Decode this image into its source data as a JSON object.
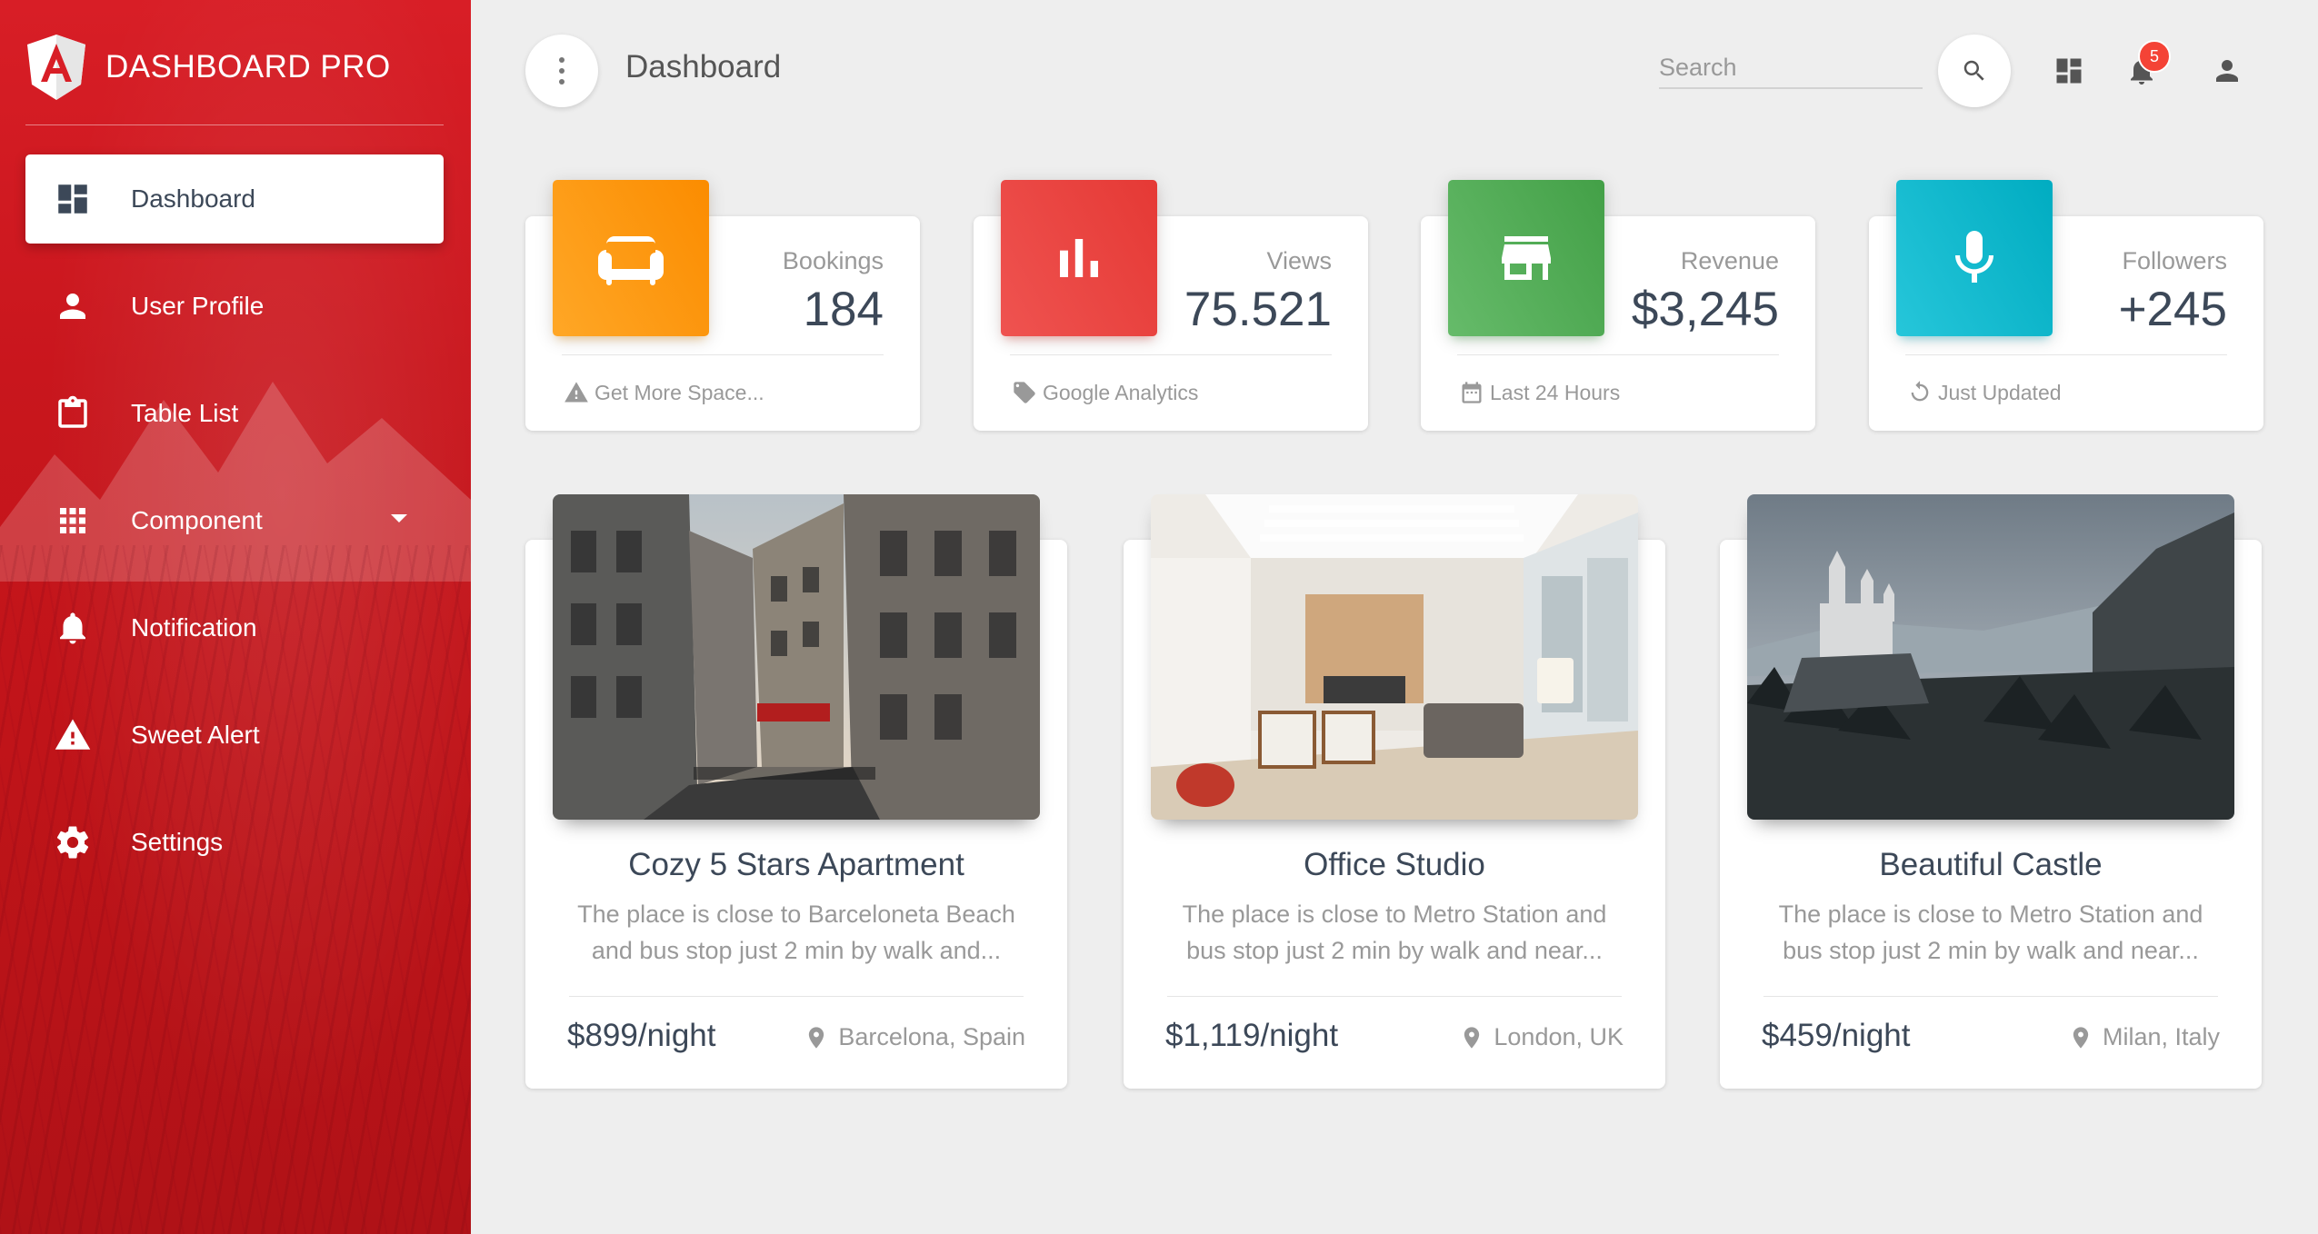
{
  "brand": {
    "title": "DASHBOARD PRO",
    "logo_letter": "A"
  },
  "sidebar": {
    "items": [
      {
        "label": "Dashboard",
        "icon": "dashboard-icon",
        "active": true
      },
      {
        "label": "User Profile",
        "icon": "person-icon",
        "active": false
      },
      {
        "label": "Table List",
        "icon": "clipboard-icon",
        "active": false
      },
      {
        "label": "Component",
        "icon": "apps-grid-icon",
        "active": false,
        "has_dropdown": true
      },
      {
        "label": "Notification",
        "icon": "bell-icon",
        "active": false
      },
      {
        "label": "Sweet Alert",
        "icon": "warning-icon",
        "active": false
      },
      {
        "label": "Settings",
        "icon": "gear-icon",
        "active": false
      }
    ]
  },
  "header": {
    "title": "Dashboard",
    "search_placeholder": "Search",
    "notification_count": "5"
  },
  "stats": [
    {
      "label": "Bookings",
      "value": "184",
      "footer": "Get More Space...",
      "footer_icon": "warning-icon",
      "color": "#ff9800",
      "icon": "sofa-icon"
    },
    {
      "label": "Views",
      "value": "75.521",
      "footer": "Google Analytics",
      "footer_icon": "tag-icon",
      "color": "#e53935",
      "icon": "bar-chart-icon"
    },
    {
      "label": "Revenue",
      "value": "$3,245",
      "footer": "Last 24 Hours",
      "footer_icon": "calendar-icon",
      "color": "#43a047",
      "icon": "store-icon"
    },
    {
      "label": "Followers",
      "value": "+245",
      "footer": "Just Updated",
      "footer_icon": "refresh-icon",
      "color": "#00acc1",
      "icon": "mic-icon"
    }
  ],
  "products": [
    {
      "title": "Cozy 5 Stars Apartment",
      "desc_line1": "The place is close to Barceloneta Beach",
      "desc_line2": "and bus stop just 2 min by walk and...",
      "price": "$899/night",
      "location": "Barcelona, Spain"
    },
    {
      "title": "Office Studio",
      "desc_line1": "The place is close to Metro Station and",
      "desc_line2": "bus stop just 2 min by walk and near...",
      "price": "$1,119/night",
      "location": "London, UK"
    },
    {
      "title": "Beautiful Castle",
      "desc_line1": "The place is close to Metro Station and",
      "desc_line2": "bus stop just 2 min by walk and near...",
      "price": "$459/night",
      "location": "Milan, Italy"
    }
  ],
  "colors": {
    "sidebar": "#d81e26",
    "active_text": "#3c4858",
    "badge": "#f44336"
  }
}
